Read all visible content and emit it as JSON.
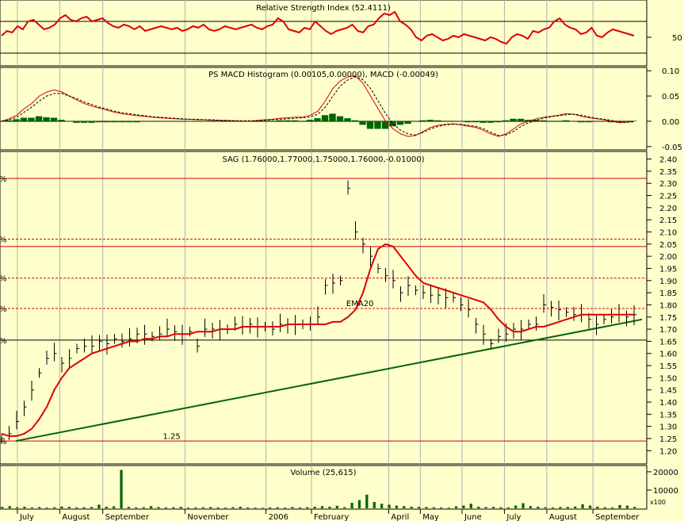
{
  "chart_data": [
    {
      "type": "line",
      "panel": "rsi",
      "title": "Relative Strength Index (52.4111)",
      "ylim": [
        15,
        95
      ],
      "yticks": [
        50
      ],
      "reference_lines": [
        30,
        70
      ],
      "series": [
        {
          "color": "#dd0000",
          "values": [
            52,
            58,
            56,
            64,
            60,
            70,
            72,
            66,
            60,
            62,
            66,
            74,
            78,
            72,
            70,
            74,
            76,
            70,
            72,
            74,
            68,
            64,
            62,
            66,
            64,
            60,
            64,
            58,
            60,
            62,
            64,
            62,
            60,
            62,
            58,
            60,
            64,
            62,
            66,
            60,
            58,
            60,
            64,
            62,
            60,
            62,
            64,
            66,
            62,
            60,
            64,
            66,
            74,
            70,
            60,
            58,
            56,
            62,
            60,
            70,
            64,
            58,
            54,
            58,
            60,
            62,
            66,
            58,
            56,
            64,
            66,
            74,
            80,
            78,
            82,
            70,
            66,
            60,
            50,
            46,
            52,
            54,
            50,
            46,
            48,
            52,
            50,
            54,
            52,
            50,
            48,
            46,
            50,
            48,
            44,
            42,
            50,
            54,
            52,
            48,
            58,
            56,
            60,
            62,
            70,
            74,
            66,
            62,
            60,
            54,
            56,
            62,
            52,
            50,
            56,
            60,
            58,
            56,
            54,
            52
          ]
        }
      ],
      "last_label": "52.4111"
    },
    {
      "type": "line",
      "panel": "macd",
      "title": "PS MACD Histogram (0.00105,0.00000), MACD (-0.00049)",
      "ylim": [
        -0.055,
        0.105
      ],
      "yticks": [
        0.1,
        0.05,
        0.0,
        -0.05
      ],
      "ytick_labels": [
        "0.10",
        "0.05",
        "0.00",
        "-0.05"
      ],
      "series": [
        {
          "color": "#dd0000",
          "values": [
            0.0,
            0.005,
            0.012,
            0.025,
            0.035,
            0.05,
            0.058,
            0.062,
            0.058,
            0.05,
            0.042,
            0.035,
            0.03,
            0.026,
            0.022,
            0.018,
            0.015,
            0.013,
            0.011,
            0.01,
            0.008,
            0.007,
            0.006,
            0.005,
            0.004,
            0.004,
            0.003,
            0.003,
            0.002,
            0.002,
            0.001,
            0.001,
            0.0,
            0.0,
            0.002,
            0.003,
            0.004,
            0.006,
            0.007,
            0.008,
            0.008,
            0.012,
            0.02,
            0.04,
            0.065,
            0.08,
            0.088,
            0.09,
            0.075,
            0.05,
            0.025,
            0.0,
            -0.015,
            -0.025,
            -0.03,
            -0.028,
            -0.02,
            -0.012,
            -0.008,
            -0.006,
            -0.005,
            -0.007,
            -0.01,
            -0.012,
            -0.018,
            -0.025,
            -0.03,
            -0.025,
            -0.015,
            -0.005,
            0.0,
            0.005,
            0.008,
            0.01,
            0.012,
            0.015,
            0.014,
            0.01,
            0.007,
            0.005,
            0.003,
            0.0,
            -0.003,
            -0.002,
            0.0
          ]
        },
        {
          "color": "#000000",
          "dashed": true,
          "values": [
            0.0,
            0.003,
            0.008,
            0.018,
            0.028,
            0.04,
            0.05,
            0.055,
            0.055,
            0.05,
            0.045,
            0.038,
            0.033,
            0.028,
            0.024,
            0.02,
            0.017,
            0.015,
            0.013,
            0.011,
            0.009,
            0.008,
            0.007,
            0.006,
            0.005,
            0.004,
            0.004,
            0.003,
            0.003,
            0.002,
            0.002,
            0.001,
            0.001,
            0.001,
            0.001,
            0.002,
            0.003,
            0.004,
            0.005,
            0.006,
            0.007,
            0.009,
            0.014,
            0.028,
            0.05,
            0.07,
            0.082,
            0.088,
            0.082,
            0.065,
            0.04,
            0.015,
            -0.005,
            -0.018,
            -0.025,
            -0.027,
            -0.022,
            -0.015,
            -0.01,
            -0.007,
            -0.006,
            -0.006,
            -0.008,
            -0.01,
            -0.015,
            -0.022,
            -0.028,
            -0.027,
            -0.02,
            -0.01,
            -0.003,
            0.002,
            0.006,
            0.009,
            0.011,
            0.013,
            0.014,
            0.012,
            0.009,
            0.006,
            0.004,
            0.002,
            -0.001,
            -0.002,
            -0.001
          ]
        }
      ],
      "histogram": [
        0.0,
        0.002,
        0.004,
        0.007,
        0.007,
        0.01,
        0.008,
        0.007,
        0.003,
        0.0,
        -0.003,
        -0.003,
        -0.003,
        -0.002,
        -0.002,
        -0.002,
        -0.002,
        -0.002,
        -0.002,
        -0.001,
        -0.001,
        -0.001,
        -0.001,
        -0.001,
        -0.001,
        0.0,
        -0.001,
        0.0,
        -0.001,
        0.0,
        -0.001,
        0.0,
        -0.001,
        -0.001,
        0.001,
        0.001,
        0.001,
        0.002,
        0.002,
        0.002,
        0.001,
        0.003,
        0.006,
        0.012,
        0.015,
        0.01,
        0.006,
        0.002,
        -0.007,
        -0.015,
        -0.015,
        -0.015,
        -0.01,
        -0.007,
        -0.005,
        -0.001,
        0.002,
        0.003,
        0.002,
        0.001,
        0.001,
        -0.001,
        -0.002,
        -0.002,
        -0.003,
        -0.003,
        -0.002,
        0.002,
        0.005,
        0.005,
        0.003,
        0.003,
        0.002,
        0.001,
        0.001,
        0.002,
        0.0,
        -0.002,
        -0.002,
        -0.001,
        -0.001,
        -0.002,
        -0.002,
        0.0,
        0.001
      ]
    },
    {
      "type": "line",
      "panel": "price",
      "title": "SAG (1.76000,1.77000,1.75000,1.76000,-0.01000)",
      "ylim": [
        1.175,
        2.405
      ],
      "yticks": [
        2.4,
        2.35,
        2.3,
        2.25,
        2.2,
        2.15,
        2.1,
        2.05,
        2.0,
        1.95,
        1.9,
        1.85,
        1.8,
        1.75,
        1.7,
        1.65,
        1.6,
        1.55,
        1.5,
        1.45,
        1.4,
        1.35,
        1.3,
        1.25,
        1.2
      ],
      "ytick_labels": [
        "2.40",
        "2.35",
        "2.30",
        "2.25",
        "2.20",
        "2.15",
        "2.10",
        "2.05",
        "2.00",
        "1.95",
        "1.90",
        "1.85",
        "1.80",
        "1.75",
        "1.70",
        "1.65",
        "1.60",
        "1.55",
        "1.50",
        "1.45",
        "1.40",
        "1.35",
        "1.30",
        "1.25",
        "1.20"
      ],
      "horizontal_lines": [
        {
          "y": 2.32,
          "color": "#cc0000",
          "dashed": false
        },
        {
          "y": 2.07,
          "color": "#cc0000",
          "dashed": true
        },
        {
          "y": 2.04,
          "color": "#cc0000",
          "dashed": false
        },
        {
          "y": 1.91,
          "color": "#cc0000",
          "dashed": true
        },
        {
          "y": 1.785,
          "color": "#cc0000",
          "dashed": true
        },
        {
          "y": 1.655,
          "color": "#000000",
          "dashed": false
        },
        {
          "y": 1.24,
          "color": "#cc0000",
          "dashed": false
        }
      ],
      "left_percent_marks": [
        2.32,
        2.07,
        1.91,
        1.785,
        1.655,
        1.24
      ],
      "left_mark_text": "%",
      "annotations": [
        {
          "text": "EMA20",
          "x": 0.545,
          "y": 1.795,
          "color": "#dd0000"
        },
        {
          "text": "1.25",
          "x": 0.255,
          "y": 1.248,
          "color": "#008800"
        }
      ],
      "trendline": {
        "color": "#006600",
        "from": [
          0.0,
          1.24
        ],
        "to": [
          1.0,
          1.74
        ]
      },
      "series": [
        {
          "name": "EMA20",
          "color": "#dd0000",
          "values": [
            1.27,
            1.26,
            1.26,
            1.27,
            1.29,
            1.33,
            1.38,
            1.45,
            1.5,
            1.54,
            1.56,
            1.58,
            1.6,
            1.61,
            1.62,
            1.63,
            1.64,
            1.65,
            1.65,
            1.66,
            1.66,
            1.67,
            1.67,
            1.68,
            1.68,
            1.68,
            1.69,
            1.69,
            1.69,
            1.7,
            1.7,
            1.7,
            1.71,
            1.71,
            1.71,
            1.71,
            1.71,
            1.71,
            1.72,
            1.72,
            1.72,
            1.72,
            1.72,
            1.72,
            1.73,
            1.73,
            1.75,
            1.78,
            1.85,
            1.95,
            2.03,
            2.05,
            2.04,
            2.0,
            1.96,
            1.92,
            1.89,
            1.88,
            1.87,
            1.86,
            1.85,
            1.84,
            1.83,
            1.82,
            1.81,
            1.78,
            1.74,
            1.71,
            1.69,
            1.69,
            1.7,
            1.71,
            1.71,
            1.72,
            1.73,
            1.74,
            1.75,
            1.76,
            1.76,
            1.76,
            1.76,
            1.76,
            1.76,
            1.76,
            1.76
          ]
        },
        {
          "name": "Close",
          "color": "#000000",
          "values": [
            1.25,
            1.27,
            1.32,
            1.38,
            1.45,
            1.52,
            1.58,
            1.6,
            1.56,
            1.58,
            1.62,
            1.63,
            1.63,
            1.65,
            1.64,
            1.66,
            1.65,
            1.66,
            1.68,
            1.68,
            1.67,
            1.68,
            1.7,
            1.69,
            1.68,
            1.69,
            1.63,
            1.7,
            1.7,
            1.7,
            1.7,
            1.72,
            1.71,
            1.72,
            1.71,
            1.71,
            1.7,
            1.72,
            1.72,
            1.72,
            1.72,
            1.72,
            1.75,
            1.88,
            1.89,
            1.9,
            2.28,
            2.1,
            2.05,
            2.0,
            1.95,
            1.92,
            1.9,
            1.85,
            1.88,
            1.86,
            1.85,
            1.84,
            1.84,
            1.83,
            1.83,
            1.8,
            1.78,
            1.72,
            1.68,
            1.64,
            1.67,
            1.68,
            1.7,
            1.7,
            1.72,
            1.72,
            1.8,
            1.79,
            1.78,
            1.77,
            1.76,
            1.76,
            1.74,
            1.72,
            1.74,
            1.75,
            1.76,
            1.75,
            1.76
          ]
        }
      ]
    },
    {
      "type": "bar",
      "panel": "volume",
      "title": "Volume (25,615)",
      "ylim": [
        0,
        23000
      ],
      "yticks": [
        20000,
        10000
      ],
      "ytick_labels": [
        "20000",
        "10000"
      ],
      "unit_label": "x100",
      "values": [
        800,
        1200,
        600,
        900,
        500,
        700,
        400,
        600,
        1000,
        800,
        500,
        600,
        700,
        2000,
        900,
        1100,
        21000,
        800,
        500,
        600,
        1200,
        700,
        500,
        600,
        800,
        400,
        500,
        600,
        700,
        500,
        400,
        600,
        900,
        500,
        400,
        300,
        500,
        600,
        400,
        700,
        500,
        600,
        900,
        1200,
        900,
        1400,
        600,
        3000,
        4500,
        7500,
        3500,
        2500,
        2000,
        1500,
        1200,
        900,
        800,
        700,
        600,
        500,
        400,
        1100,
        1500,
        2500,
        900,
        700,
        800,
        600,
        500,
        1500,
        2800,
        1200,
        900,
        600,
        500,
        700,
        800,
        1000,
        2200,
        1500,
        900,
        600,
        500,
        1800,
        1500,
        800
      ]
    }
  ],
  "x_axis": {
    "month_labels": [
      "July",
      "August",
      "September",
      "November",
      "2006",
      "February",
      "April",
      "May",
      "June",
      "July",
      "August",
      "September"
    ],
    "month_positions": [
      0.025,
      0.092,
      0.16,
      0.29,
      0.418,
      0.49,
      0.612,
      0.662,
      0.728,
      0.795,
      0.862,
      0.935
    ]
  },
  "colors": {
    "background": "#ffffcc",
    "grid": "#b0b0b0",
    "rsi_line": "#dd0000",
    "macd_line": "#dd0000",
    "histogram": "#006600",
    "ema": "#dd0000",
    "trendline": "#006600",
    "price_bars": "#000000",
    "volume_bars": "#006600"
  }
}
